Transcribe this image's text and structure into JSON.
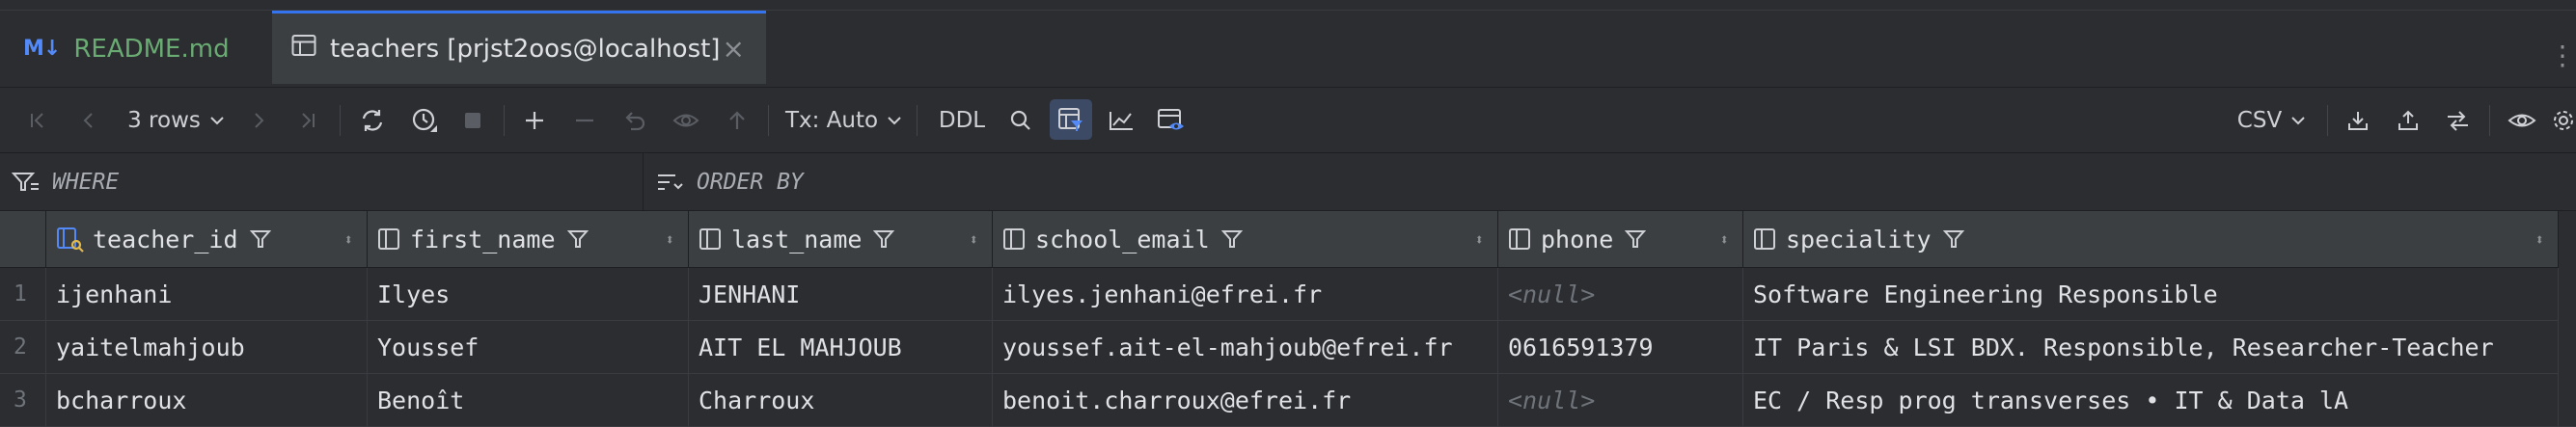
{
  "tabs": [
    {
      "icon": "M↓",
      "label": "README.md"
    },
    {
      "label": "teachers [prjst2oos@localhost]",
      "close": "×"
    }
  ],
  "toolbar": {
    "rows_label": "3 rows",
    "tx_label": "Tx: Auto",
    "ddl_label": "DDL",
    "csv_label": "CSV"
  },
  "filter": {
    "where_label": "WHERE",
    "order_label": "ORDER BY"
  },
  "columns": [
    {
      "name": "teacher_id"
    },
    {
      "name": "first_name"
    },
    {
      "name": "last_name"
    },
    {
      "name": "school_email"
    },
    {
      "name": "phone"
    },
    {
      "name": "speciality"
    }
  ],
  "rows": [
    {
      "num": "1",
      "cells": [
        "ijenhani",
        "Ilyes",
        "JENHANI",
        "ilyes.jenhani@efrei.fr",
        "<null>",
        "Software Engineering Responsible"
      ]
    },
    {
      "num": "2",
      "cells": [
        "yaitelmahjoub",
        "Youssef",
        "AIT EL MAHJOUB",
        "youssef.ait-el-mahjoub@efrei.fr",
        "0616591379",
        "IT Paris & LSI BDX. Responsible, Researcher-Teacher"
      ]
    },
    {
      "num": "3",
      "cells": [
        "bcharroux",
        "Benoît",
        "Charroux",
        "benoit.charroux@efrei.fr",
        "<null>",
        "EC / Resp prog transverses • IT & Data lA"
      ]
    }
  ],
  "colors": {
    "accent": "#3574f0",
    "tab_readme": "#6aab73",
    "null_text": "#6f737a"
  }
}
